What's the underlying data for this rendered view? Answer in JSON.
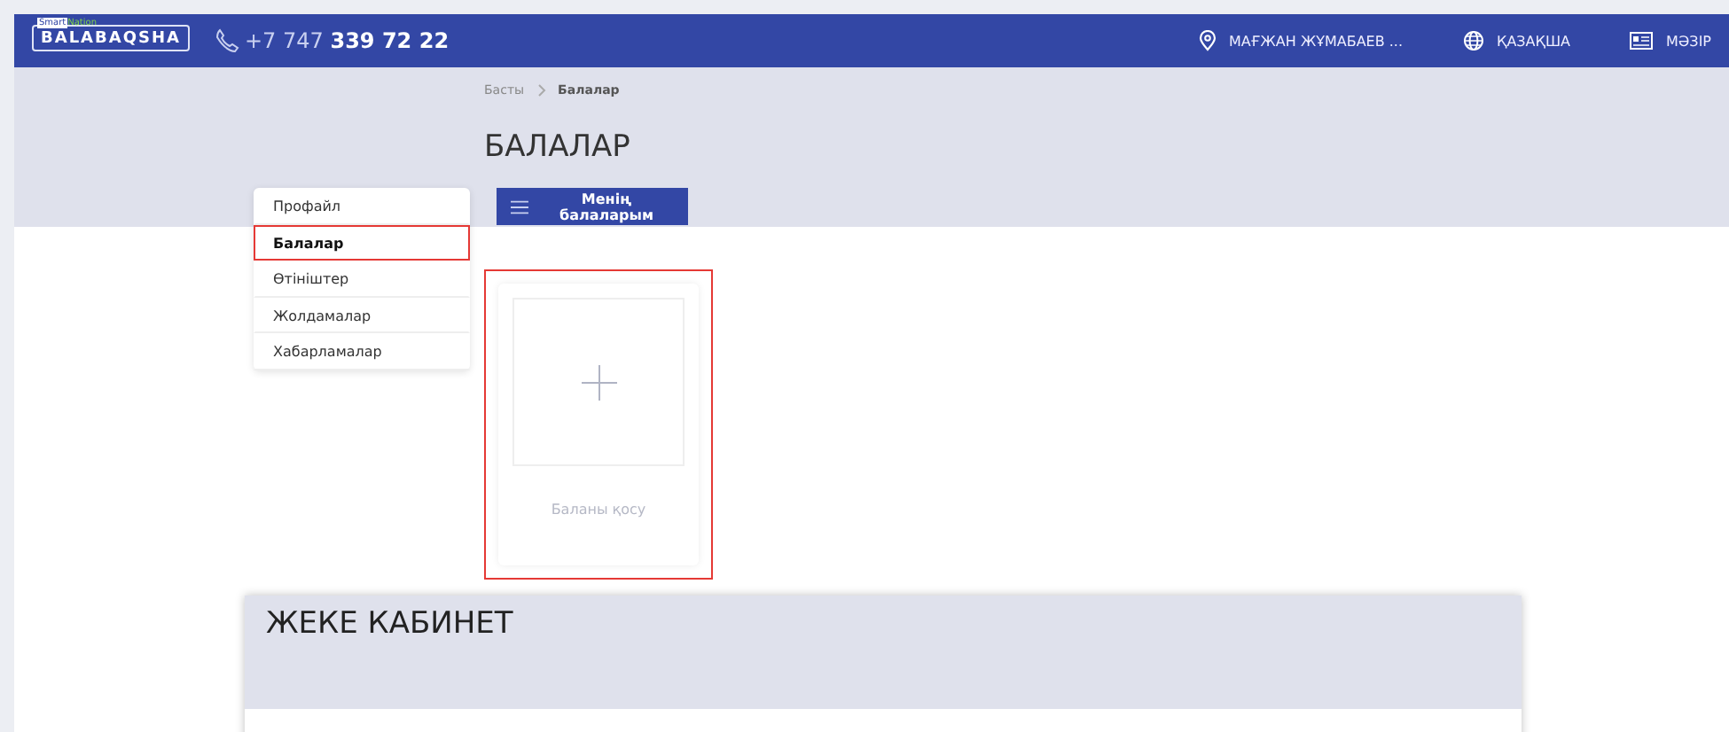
{
  "header": {
    "logo": {
      "top_left": "Smart",
      "top_right": "Nation",
      "main": "BALABAQSHA"
    },
    "phone": {
      "prefix": "+7 747",
      "number": "339 72 22"
    },
    "nav": [
      {
        "kind": "location",
        "label": "МАҒЖАН ЖҰМАБАЕВ ..."
      },
      {
        "kind": "language",
        "label": "ҚАЗАҚША"
      },
      {
        "kind": "menu",
        "label": "МӘЗІР"
      }
    ]
  },
  "breadcrumb": [
    {
      "label": "Басты",
      "current": false
    },
    {
      "label": "Балалар",
      "current": true
    }
  ],
  "page_title": "БАЛАЛАР",
  "sidebar": {
    "items": [
      {
        "label": "Профайл",
        "selected": false,
        "highlighted": false
      },
      {
        "label": "Балалар",
        "selected": true,
        "highlighted": true
      },
      {
        "label": "Өтініштер",
        "selected": false,
        "highlighted": false
      },
      {
        "label": "Жолдамалар",
        "selected": false,
        "highlighted": false
      },
      {
        "label": "Хабарламалар",
        "selected": false,
        "highlighted": false
      }
    ]
  },
  "tab_button": "Менің балаларым",
  "add_card": {
    "label": "Баланы қосу",
    "highlighted": true
  },
  "cabinet": {
    "title": "ЖЕКЕ КАБИНЕТ"
  }
}
